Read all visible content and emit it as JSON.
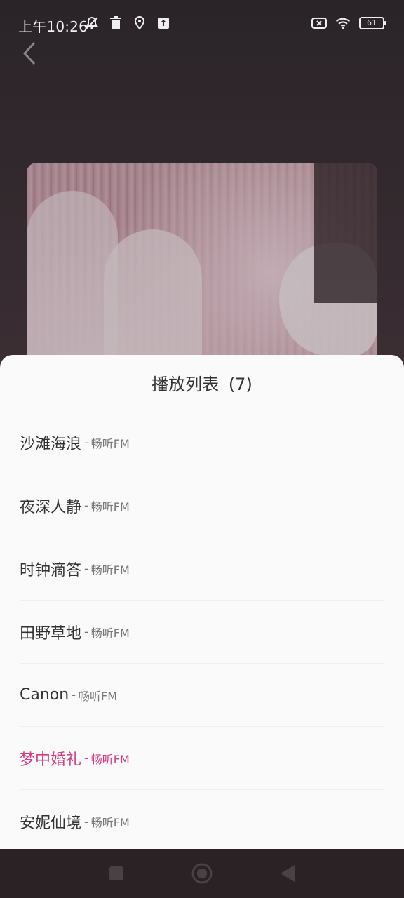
{
  "status_bar": {
    "time": "上午10:26",
    "battery": "61",
    "icons_left": [
      "mute-bell-icon",
      "trash-icon",
      "location-icon",
      "upload-icon"
    ],
    "icons_right": [
      "sim-x-icon",
      "wifi-icon",
      "battery-icon"
    ]
  },
  "player": {
    "back_icon": "chevron-left-icon",
    "cover": "wedding-cover-image"
  },
  "playlist": {
    "title": "播放列表",
    "count": "(7)",
    "separator": "-",
    "items": [
      {
        "name": "沙滩海浪",
        "source": "畅听FM",
        "active": false
      },
      {
        "name": "夜深人静",
        "source": "畅听FM",
        "active": false
      },
      {
        "name": "时钟滴答",
        "source": "畅听FM",
        "active": false
      },
      {
        "name": "田野草地",
        "source": "畅听FM",
        "active": false
      },
      {
        "name": "Canon",
        "source": "畅听FM",
        "active": false
      },
      {
        "name": "梦中婚礼",
        "source": "畅听FM",
        "active": true
      },
      {
        "name": "安妮仙境",
        "source": "畅听FM",
        "active": false
      }
    ]
  },
  "nav_bar": {
    "icons": [
      "recent-apps-icon",
      "home-icon",
      "back-icon"
    ]
  },
  "colors": {
    "accent": "#d63b7f",
    "sheet_bg": "#fafafa",
    "text": "#333333",
    "subtext": "#777777"
  }
}
